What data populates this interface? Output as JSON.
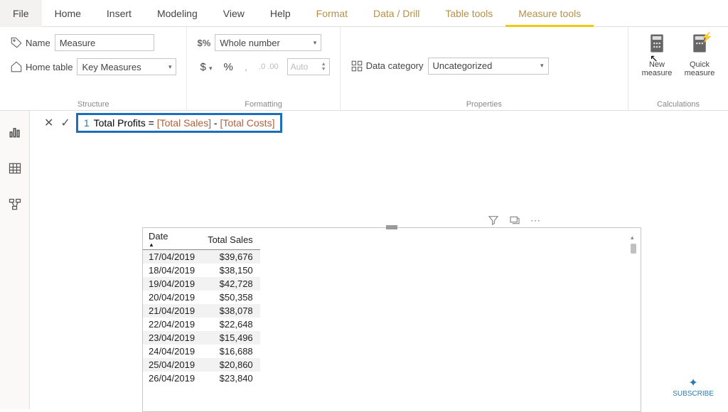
{
  "tabs": {
    "file": "File",
    "home": "Home",
    "insert": "Insert",
    "modeling": "Modeling",
    "view": "View",
    "help": "Help",
    "format": "Format",
    "data_drill": "Data / Drill",
    "table_tools": "Table tools",
    "measure_tools": "Measure tools"
  },
  "ribbon": {
    "structure": {
      "label": "Structure",
      "name_label": "Name",
      "name_value": "Measure",
      "home_table_label": "Home table",
      "home_table_value": "Key Measures"
    },
    "formatting": {
      "label": "Formatting",
      "format_value": "Whole number",
      "auto_placeholder": "Auto",
      "dollar": "$",
      "percent": "%",
      "comma": ",",
      "decimal_inc": ".0",
      "decimal_dec": ".00"
    },
    "properties": {
      "label": "Properties",
      "data_category_label": "Data category",
      "data_category_value": "Uncategorized"
    },
    "calculations": {
      "label": "Calculations",
      "new_measure": "New measure",
      "quick_measure": "Quick measure"
    }
  },
  "formula": {
    "line": "1",
    "name": "Total Profits",
    "eq": " = ",
    "ref1": "[Total Sales]",
    "minus": " - ",
    "ref2": "[Total Costs]"
  },
  "table": {
    "headers": {
      "date": "Date",
      "sales": "Total Sales"
    },
    "rows": [
      {
        "date": "17/04/2019",
        "sales": "$39,676"
      },
      {
        "date": "18/04/2019",
        "sales": "$38,150"
      },
      {
        "date": "19/04/2019",
        "sales": "$42,728"
      },
      {
        "date": "20/04/2019",
        "sales": "$50,358"
      },
      {
        "date": "21/04/2019",
        "sales": "$38,078"
      },
      {
        "date": "22/04/2019",
        "sales": "$22,648"
      },
      {
        "date": "23/04/2019",
        "sales": "$15,496"
      },
      {
        "date": "24/04/2019",
        "sales": "$16,688"
      },
      {
        "date": "25/04/2019",
        "sales": "$20,860"
      },
      {
        "date": "26/04/2019",
        "sales": "$23,840"
      }
    ]
  },
  "subscribe": "SUBSCRIBE"
}
